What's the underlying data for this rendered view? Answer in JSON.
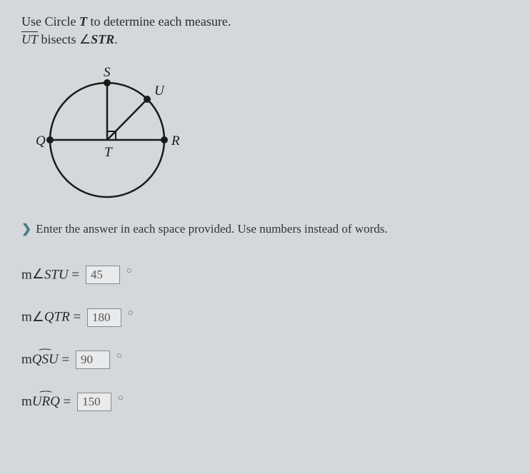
{
  "instructions": {
    "line1_pre": "Use Circle ",
    "line1_var": "T",
    "line1_post": " to determine each measure.",
    "line2_seg": "UT",
    "line2_mid": " bisects ",
    "line2_angle": "STR",
    "line2_end": "."
  },
  "diagram": {
    "labels": {
      "S": "S",
      "U": "U",
      "Q": "Q",
      "R": "R",
      "T": "T"
    }
  },
  "prompt": "Enter the answer in each space provided. Use numbers instead of words.",
  "answers": [
    {
      "prefix": "m",
      "symbol": "angle",
      "vars": "STU",
      "value": "45"
    },
    {
      "prefix": "m",
      "symbol": "angle",
      "vars": "QTR",
      "value": "180"
    },
    {
      "prefix": "m",
      "symbol": "arc",
      "vars": "QSU",
      "value": "90"
    },
    {
      "prefix": "m",
      "symbol": "arc",
      "vars": "URQ",
      "value": "150"
    }
  ]
}
